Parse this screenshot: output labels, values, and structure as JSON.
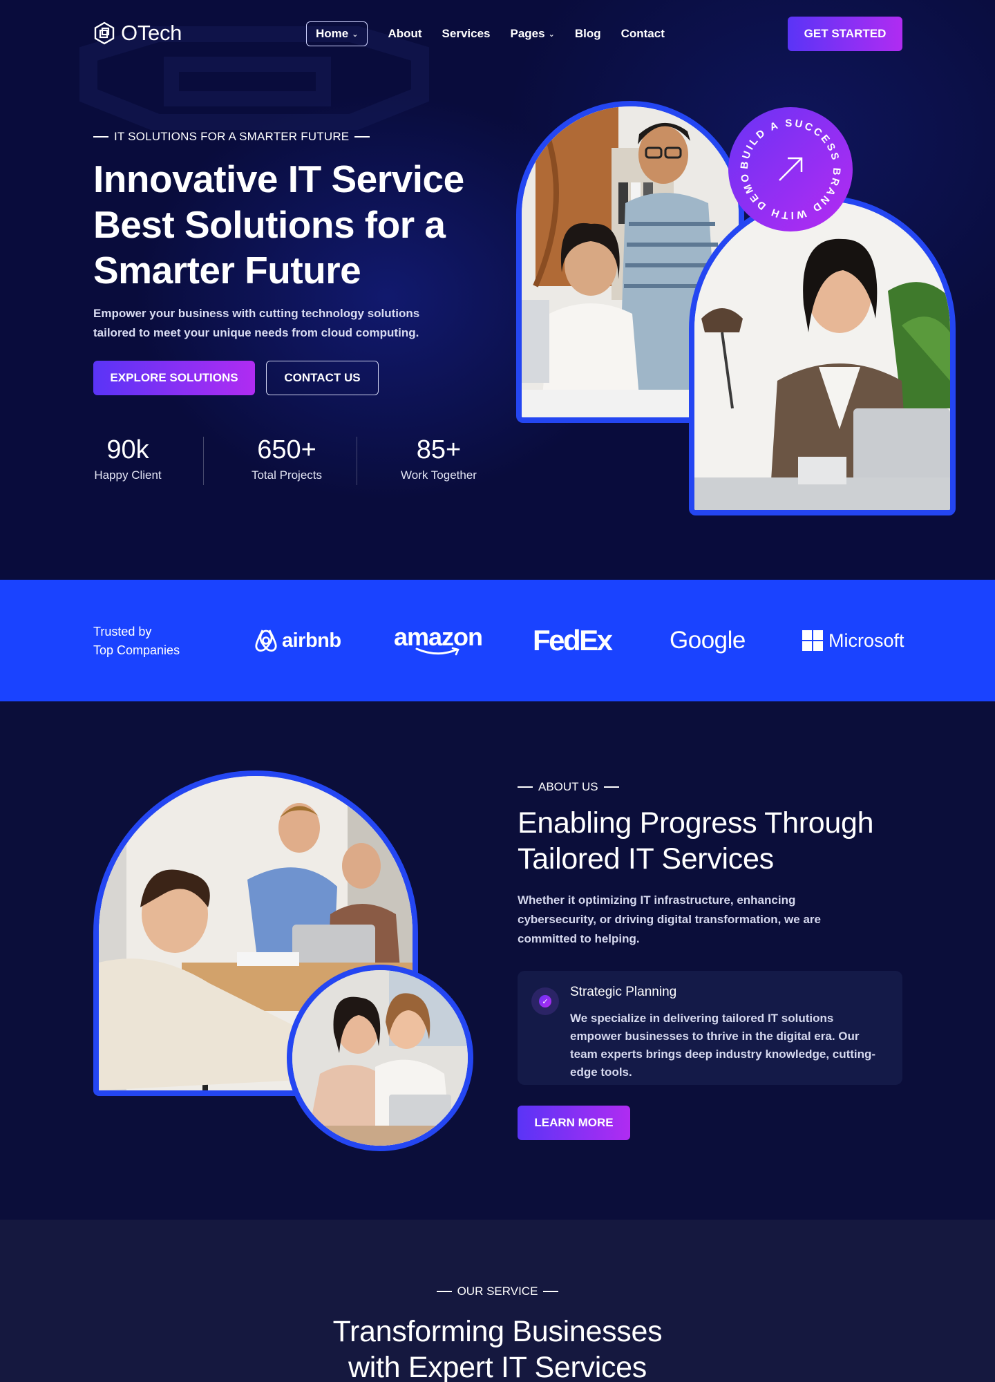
{
  "brand": {
    "name": "OTech",
    "icon": "hexagon-cube-logo-icon"
  },
  "nav": {
    "items": [
      {
        "label": "Home",
        "dropdown": true,
        "active": true
      },
      {
        "label": "About",
        "dropdown": false
      },
      {
        "label": "Services",
        "dropdown": false
      },
      {
        "label": "Pages",
        "dropdown": true
      },
      {
        "label": "Blog",
        "dropdown": false
      },
      {
        "label": "Contact",
        "dropdown": false
      }
    ],
    "cta_label": "GET STARTED"
  },
  "hero": {
    "kicker": "IT SOLUTIONS FOR A SMARTER FUTURE",
    "title_lines": [
      "Innovative IT Service",
      "Best Solutions for a",
      "Smarter Future"
    ],
    "description_lines": [
      "Empower your business with cutting technology solutions",
      "tailored to meet your unique needs from cloud computing."
    ],
    "primary_button": "EXPLORE SOLUTIONS",
    "secondary_button": "CONTACT US",
    "stats": [
      {
        "value": "90k",
        "label": "Happy Client"
      },
      {
        "value": "650+",
        "label": "Total Projects"
      },
      {
        "value": "85+",
        "label": "Work Together"
      }
    ],
    "badge_text": "BUILD A SUCCESS BRAND WITH DEMOUI"
  },
  "trusted": {
    "label_lines": [
      "Trusted by",
      "Top Companies"
    ],
    "logos": [
      "airbnb",
      "amazon",
      "FedEx",
      "Google",
      "Microsoft"
    ]
  },
  "about": {
    "kicker": "ABOUT US",
    "title_lines": [
      "Enabling Progress Through",
      "Tailored IT Services"
    ],
    "description_lines": [
      "Whether it optimizing IT infrastructure, enhancing",
      "cybersecurity, or driving digital transformation, we are",
      "committed to helping."
    ],
    "feature": {
      "title": "Strategic Planning",
      "text_lines": [
        "We specialize in delivering tailored IT solutions",
        "empower businesses to thrive in the digital era. Our",
        "team experts brings deep industry knowledge, cutting-",
        "edge tools."
      ]
    },
    "button": "LEARN MORE"
  },
  "services": {
    "kicker": "OUR SERVICE",
    "title_lines": [
      "Transforming Businesses",
      "with Expert IT Services"
    ]
  },
  "colors": {
    "background": "#0b0e3a",
    "accent_blue": "#1a43ff",
    "frame_blue": "#2446f2",
    "gradient_start": "#5a34f6",
    "gradient_end": "#b02cf2"
  }
}
